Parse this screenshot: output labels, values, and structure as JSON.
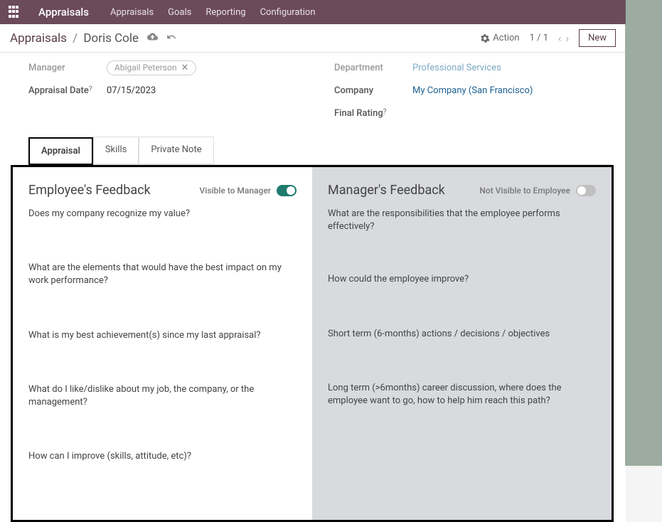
{
  "nav": {
    "brand": "Appraisals",
    "items": [
      "Appraisals",
      "Goals",
      "Reporting",
      "Configuration"
    ]
  },
  "breadcrumb": {
    "root": "Appraisals",
    "current": "Doris Cole",
    "action_label": "Action",
    "pager": "1 / 1",
    "new_label": "New"
  },
  "form": {
    "left": {
      "manager_label": "Manager",
      "manager_value": "Abigail Peterson",
      "date_label": "Appraisal Date",
      "date_value": "07/15/2023"
    },
    "right": {
      "department_label": "Department",
      "department_value": "Professional Services",
      "company_label": "Company",
      "company_value": "My Company (San Francisco)",
      "rating_label": "Final Rating"
    }
  },
  "tabs": [
    "Appraisal",
    "Skills",
    "Private Note"
  ],
  "employee_feedback": {
    "title": "Employee's Feedback",
    "visibility": "Visible to Manager",
    "toggle_on": true,
    "questions": [
      "Does my company recognize my value?",
      "What are the elements that would have the best impact on my work performance?",
      "What is my best achievement(s) since my last appraisal?",
      "What do I like/dislike about my job, the company, or the management?",
      "How can I improve (skills, attitude, etc)?"
    ]
  },
  "manager_feedback": {
    "title": "Manager's Feedback",
    "visibility": "Not Visible to Employee",
    "toggle_on": false,
    "questions": [
      "What are the responsibilities that the employee performs effectively?",
      "How could the employee improve?",
      "Short term (6-months) actions / decisions / objectives",
      "Long term (>6months) career discussion, where does the employee want to go, how to help him reach this path?"
    ]
  }
}
